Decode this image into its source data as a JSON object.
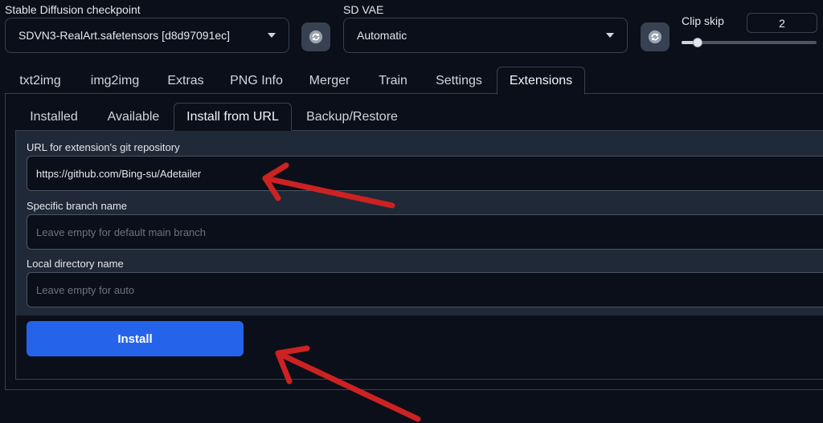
{
  "top": {
    "checkpoint_label": "Stable Diffusion checkpoint",
    "checkpoint_value": "SDVN3-RealArt.safetensors [d8d97091ec]",
    "vae_label": "SD VAE",
    "vae_value": "Automatic",
    "clip_skip_label": "Clip skip",
    "clip_skip_value": "2",
    "clip_skip_slider_fraction": 0.12
  },
  "main_tabs": [
    "txt2img",
    "img2img",
    "Extras",
    "PNG Info",
    "Merger",
    "Train",
    "Settings",
    "Extensions"
  ],
  "active_main_tab": "Extensions",
  "sub_tabs": [
    "Installed",
    "Available",
    "Install from URL",
    "Backup/Restore"
  ],
  "active_sub_tab": "Install from URL",
  "form": {
    "url_label": "URL for extension's git repository",
    "url_value": "https://github.com/Bing-su/Adetailer",
    "branch_label": "Specific branch name",
    "branch_placeholder": "Leave empty for default main branch",
    "dir_label": "Local directory name",
    "dir_placeholder": "Leave empty for auto",
    "install_label": "Install"
  },
  "colors": {
    "background": "#0b0f19",
    "accent_button": "#2563eb",
    "annotation_arrow": "#cc2222"
  },
  "icons": {
    "refresh": "refresh-icon",
    "dropdown": "chevron-down-icon",
    "annotation": "arrow-annotation"
  }
}
